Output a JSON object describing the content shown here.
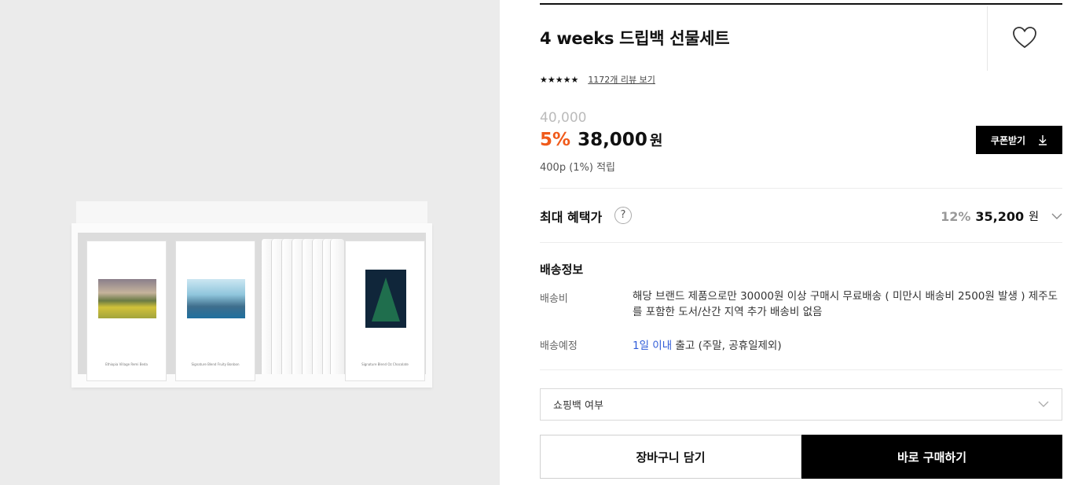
{
  "product": {
    "title": "4 weeks 드립백 선물세트",
    "stars": "★★★★★",
    "review_link": "1172개 리뷰 보기",
    "original_price": "40,000",
    "discount": "5%",
    "sale_price": "38,000",
    "currency": "원",
    "points": "400p (1%) 적립",
    "coupon_label": "쿠폰받기",
    "card_labels": [
      "Ethiopia Village Remi Beda",
      "Signature Blend Fruity Bonbon",
      "Signature Blend Oz Chocolate"
    ]
  },
  "benefit": {
    "label": "최대 혜택가",
    "help": "?",
    "percent": "12%",
    "price": "35,200",
    "currency": "원"
  },
  "shipping": {
    "title": "배송정보",
    "fee_label": "배송비",
    "fee_text": "해당 브랜드 제품으로만 30000원 이상 구매시 무료배송 ( 미만시 배송비 2500원 발생 ) 제주도를 포함한 도서/산간 지역 추가 배송비 없음",
    "eta_label": "배송예정",
    "eta_highlight": "1일 이내",
    "eta_rest": " 출고 (주말, 공휴일제외)"
  },
  "options": {
    "shopping_bag": "쇼핑백 여부"
  },
  "actions": {
    "cart": "장바구니 담기",
    "buy": "바로 구매하기"
  },
  "colors": {
    "accent_discount": "#f05a1a",
    "eta_blue": "#2f5bd8",
    "primary_button": "#000000"
  }
}
